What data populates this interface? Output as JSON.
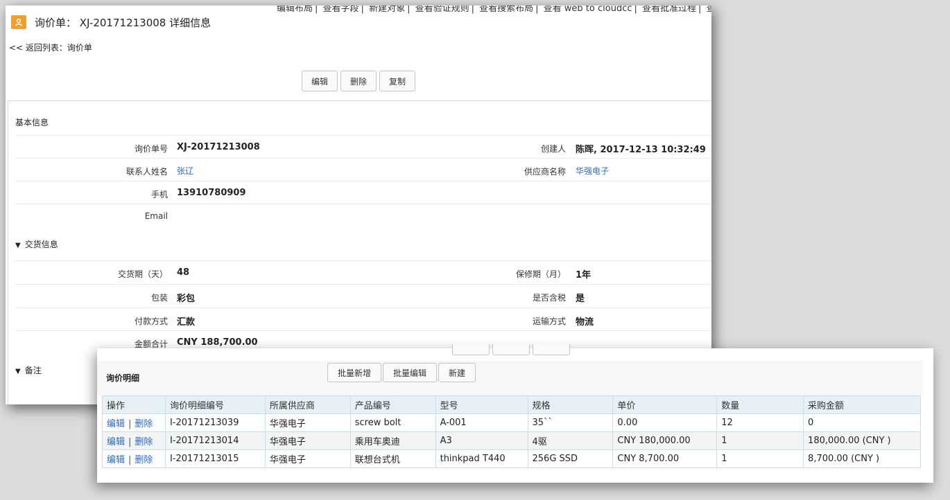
{
  "topnav": [
    "编辑布局",
    "查看字段",
    "新建对象",
    "查看验证规则",
    "查看搜索布局",
    "查看 web to cloudcc",
    "查看批准过程",
    "查"
  ],
  "header": {
    "icon": "person-icon",
    "title": "询价单： XJ-20171213008  详细信息",
    "back_link": "<< 返回列表：询价单"
  },
  "toolbar": {
    "edit": "编辑",
    "delete": "删除",
    "copy": "复制"
  },
  "basic": {
    "section_title": "基本信息",
    "fields": [
      {
        "label": "询价单号",
        "value": "XJ-20171213008"
      },
      {
        "label": "创建人",
        "value": "陈晖, 2017-12-13 10:32:49"
      },
      {
        "label": "联系人姓名",
        "value": "张辽"
      },
      {
        "label": "供应商名称",
        "value": "华强电子"
      },
      {
        "label": "手机",
        "value": "13910780909"
      },
      {
        "label": "Email",
        "value": ""
      }
    ]
  },
  "delivery": {
    "section_title": "交货信息",
    "fields": [
      {
        "label": "交货期（天）",
        "value": "48"
      },
      {
        "label": "保修期（月）",
        "value": "1年"
      },
      {
        "label": "包装",
        "value": "彩包"
      },
      {
        "label": "是否含税",
        "value": "是"
      },
      {
        "label": "付款方式",
        "value": "汇款"
      },
      {
        "label": "运输方式",
        "value": "物流"
      },
      {
        "label": "金额合计",
        "value": "CNY 188,700.00"
      }
    ]
  },
  "remarks": {
    "section_title": "备注"
  },
  "details": {
    "title": "询价明细",
    "buttons": {
      "batch_add": "批量新增",
      "batch_edit": "批量编辑",
      "new": "新建"
    },
    "columns": [
      "操作",
      "询价明细编号",
      "所属供应商",
      "产品编号",
      "型号",
      "规格",
      "单价",
      "数量",
      "采购金额"
    ],
    "action_edit": "编辑",
    "action_sep": "|",
    "action_delete": "删除",
    "rows": [
      [
        "I-20171213039",
        "华强电子",
        "screw bolt",
        "A-001",
        "35``",
        "0.00",
        "12",
        "0"
      ],
      [
        "I-20171213014",
        "华强电子",
        "乘用车奥迪",
        "A3",
        "4驱",
        "CNY 180,000.00",
        "1",
        " 180,000.00 (CNY )"
      ],
      [
        "I-20171213015",
        "华强电子",
        "联想台式机",
        "thinkpad T440",
        "256G SSD",
        "CNY 8,700.00",
        "1",
        " 8,700.00 (CNY )"
      ]
    ]
  }
}
